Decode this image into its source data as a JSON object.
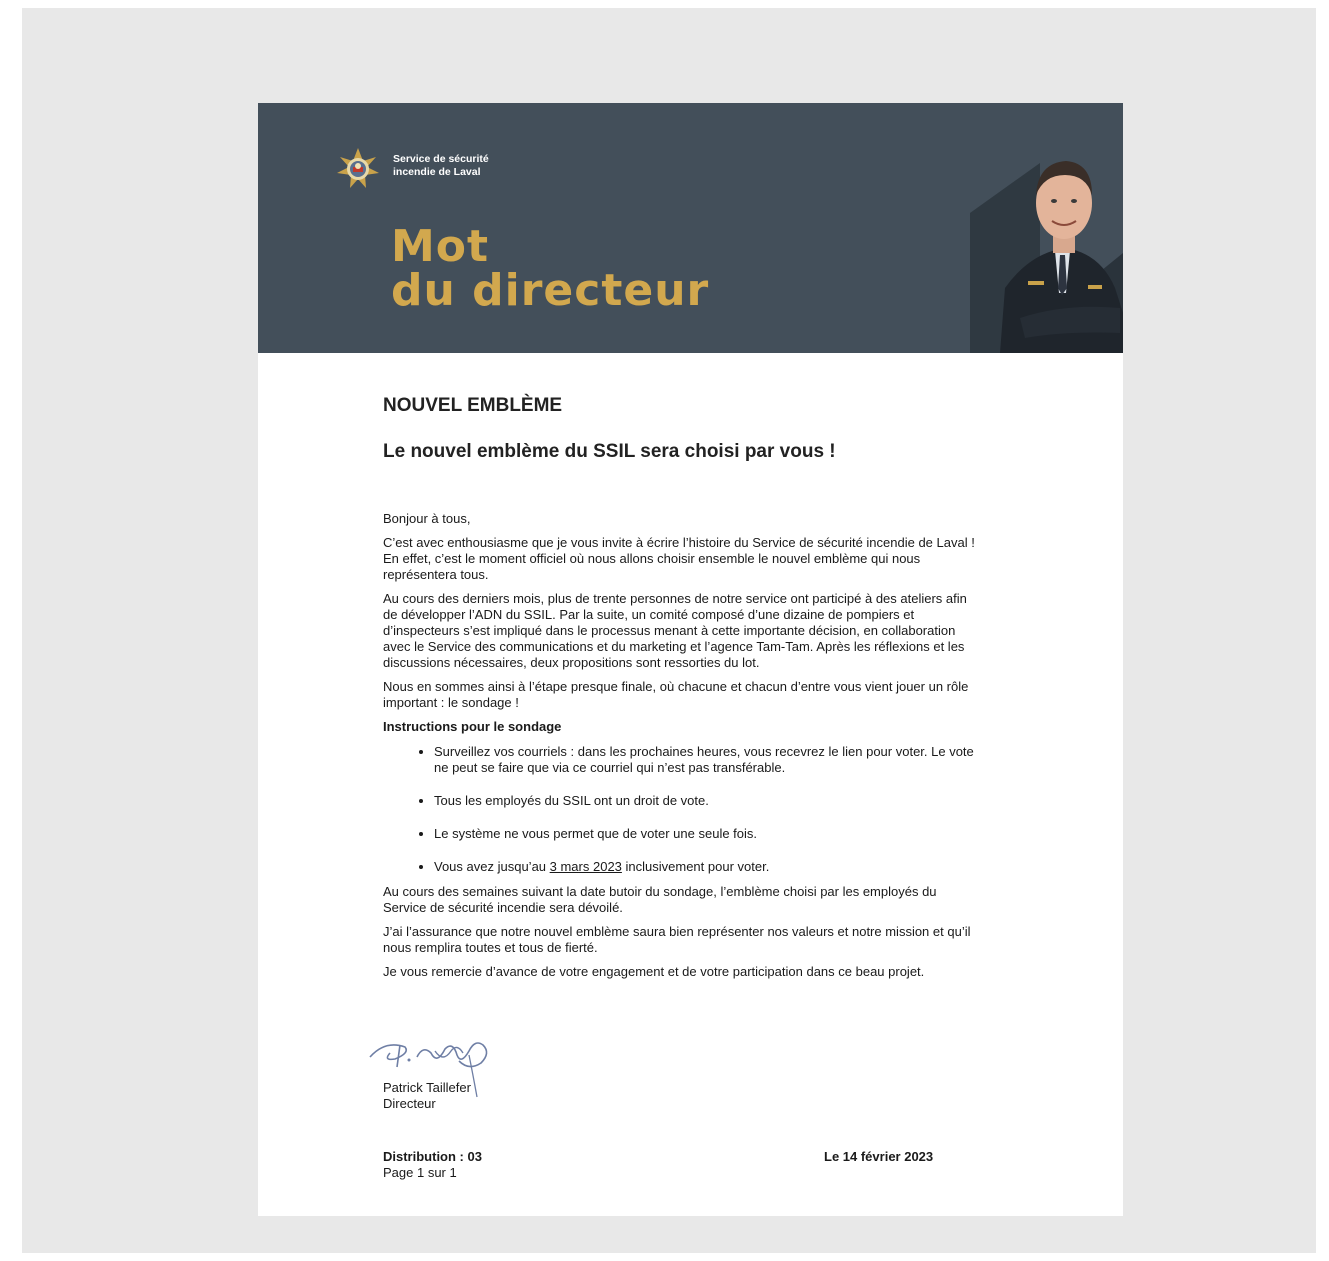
{
  "banner": {
    "org_line1": "Service de sécurité",
    "org_line2": "incendie de Laval",
    "title_line1": "Mot",
    "title_line2": "du directeur",
    "logo_icon": "fire-service-emblem-icon",
    "portrait": "director-portrait",
    "colors": {
      "background": "#434f5a",
      "title": "#d2a84e"
    }
  },
  "heading": "NOUVEL EMBLÈME",
  "subheading": "Le nouvel emblème du SSIL sera choisi par vous !",
  "paragraphs": {
    "greeting": "Bonjour à tous,",
    "p1": "C’est avec enthousiasme que je vous invite à écrire l’histoire du Service de sécurité incendie de Laval ! En effet, c’est le moment officiel où nous allons choisir ensemble le nouvel emblème qui nous représentera tous.",
    "p2": "Au cours des derniers mois, plus de trente personnes de notre service ont participé à des ateliers afin de développer l’ADN du SSIL. Par la suite, un comité composé d’une dizaine de pompiers et d’inspecteurs s’est impliqué dans le processus menant à cette importante décision, en collaboration avec le Service des communications et du marketing et l’agence Tam-Tam. Après les réflexions et les discussions nécessaires, deux propositions sont ressorties du lot.",
    "p3": "Nous en sommes ainsi à l’étape presque finale, où chacune et chacun d’entre vous vient jouer un rôle important : le sondage !",
    "instructions_title": "Instructions pour le sondage",
    "p4": "Au cours des semaines suivant la date butoir du sondage, l’emblème choisi par les employés du Service de sécurité incendie sera dévoilé.",
    "p5": "J’ai l’assurance que notre nouvel emblème saura bien représenter nos valeurs et notre mission et qu’il nous remplira toutes et tous de fierté.",
    "p6": "Je vous remercie d’avance de votre engagement et de votre participation dans ce beau projet."
  },
  "instructions": {
    "item1": "Surveillez vos courriels : dans les prochaines heures, vous recevrez le lien pour voter. Le vote ne peut se faire que via ce courriel qui n’est pas transférable.",
    "item2": "Tous les employés du SSIL ont un droit de vote.",
    "item3": "Le système ne vous permet que de voter une seule fois.",
    "item4_before": "Vous avez jusqu’au ",
    "item4_date": "3 mars 2023",
    "item4_after": " inclusivement pour voter."
  },
  "signature": {
    "name": "Patrick Taillefer",
    "role": "Directeur"
  },
  "footer": {
    "distribution": "Distribution : 03",
    "page": "Page 1 sur 1",
    "date": "Le 14 février 2023"
  }
}
